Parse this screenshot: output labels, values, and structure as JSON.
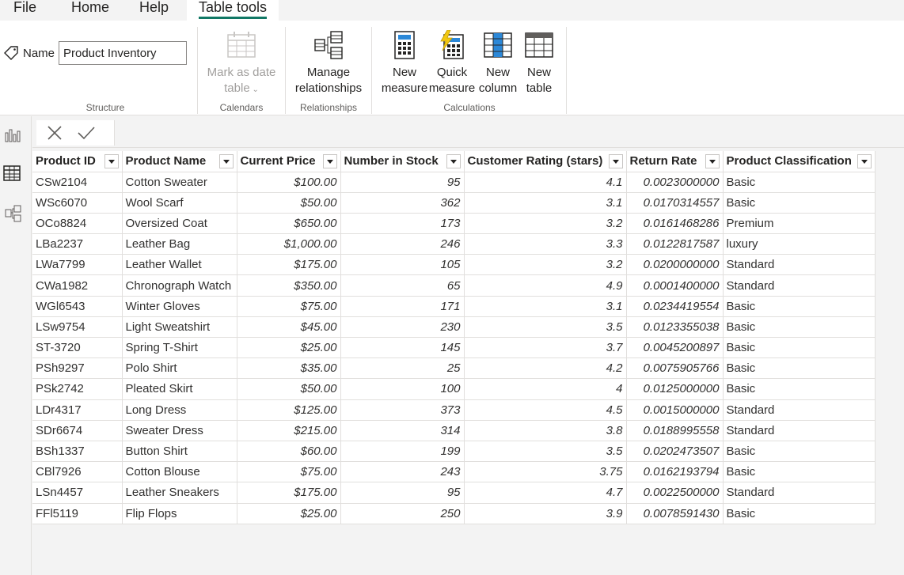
{
  "tabs": [
    "File",
    "Home",
    "Help",
    "Table tools"
  ],
  "ribbon": {
    "name_label": "Name",
    "name_value": "Product Inventory",
    "mark_date_1": "Mark as date",
    "mark_date_2": "table",
    "manage_1": "Manage",
    "manage_2": "relationships",
    "new_measure_1": "New",
    "new_measure_2": "measure",
    "quick_measure_1": "Quick",
    "quick_measure_2": "measure",
    "new_column_1": "New",
    "new_column_2": "column",
    "new_table_1": "New",
    "new_table_2": "table",
    "groups": [
      "Structure",
      "Calendars",
      "Relationships",
      "Calculations"
    ]
  },
  "table": {
    "headers": [
      "Product ID",
      "Product Name",
      "Current Price",
      "Number in Stock",
      "Customer Rating (stars)",
      "Return Rate",
      "Product Classification"
    ],
    "rows": [
      [
        "CSw2104",
        "Cotton Sweater",
        "$100.00",
        "95",
        "4.1",
        "0.0023000000",
        "Basic"
      ],
      [
        "WSc6070",
        "Wool Scarf",
        "$50.00",
        "362",
        "3.1",
        "0.0170314557",
        "Basic"
      ],
      [
        "OCo8824",
        "Oversized Coat",
        "$650.00",
        "173",
        "3.2",
        "0.0161468286",
        "Premium"
      ],
      [
        "LBa2237",
        "Leather Bag",
        "$1,000.00",
        "246",
        "3.3",
        "0.0122817587",
        "luxury"
      ],
      [
        "LWa7799",
        "Leather Wallet",
        "$175.00",
        "105",
        "3.2",
        "0.0200000000",
        "Standard"
      ],
      [
        "CWa1982",
        "Chronograph Watch",
        "$350.00",
        "65",
        "4.9",
        "0.0001400000",
        "Standard"
      ],
      [
        "WGl6543",
        "Winter Gloves",
        "$75.00",
        "171",
        "3.1",
        "0.0234419554",
        "Basic"
      ],
      [
        "LSw9754",
        "Light Sweatshirt",
        "$45.00",
        "230",
        "3.5",
        "0.0123355038",
        "Basic"
      ],
      [
        "ST-3720",
        "Spring T-Shirt",
        "$25.00",
        "145",
        "3.7",
        "0.0045200897",
        "Basic"
      ],
      [
        "PSh9297",
        "Polo Shirt",
        "$35.00",
        "25",
        "4.2",
        "0.0075905766",
        "Basic"
      ],
      [
        "PSk2742",
        "Pleated Skirt",
        "$50.00",
        "100",
        "4",
        "0.0125000000",
        "Basic"
      ],
      [
        "LDr4317",
        "Long Dress",
        "$125.00",
        "373",
        "4.5",
        "0.0015000000",
        "Standard"
      ],
      [
        "SDr6674",
        "Sweater Dress",
        "$215.00",
        "314",
        "3.8",
        "0.0188995558",
        "Standard"
      ],
      [
        "BSh1337",
        "Button Shirt",
        "$60.00",
        "199",
        "3.5",
        "0.0202473507",
        "Basic"
      ],
      [
        "CBl7926",
        "Cotton Blouse",
        "$75.00",
        "243",
        "3.75",
        "0.0162193794",
        "Basic"
      ],
      [
        "LSn4457",
        "Leather Sneakers",
        "$175.00",
        "95",
        "4.7",
        "0.0022500000",
        "Standard"
      ],
      [
        "FFl5119",
        "Flip Flops",
        "$25.00",
        "250",
        "3.9",
        "0.0078591430",
        "Basic"
      ]
    ]
  },
  "colors": {
    "accent": "#117865",
    "grid_line": "#e1dfdd"
  },
  "icons": [
    "tag-icon",
    "calendar-table-icon",
    "relationships-icon",
    "calculator-icon",
    "lightning-calculator-icon",
    "new-column-icon",
    "new-table-icon",
    "report-view-icon",
    "table-view-icon",
    "model-view-icon",
    "close-icon",
    "check-icon"
  ]
}
